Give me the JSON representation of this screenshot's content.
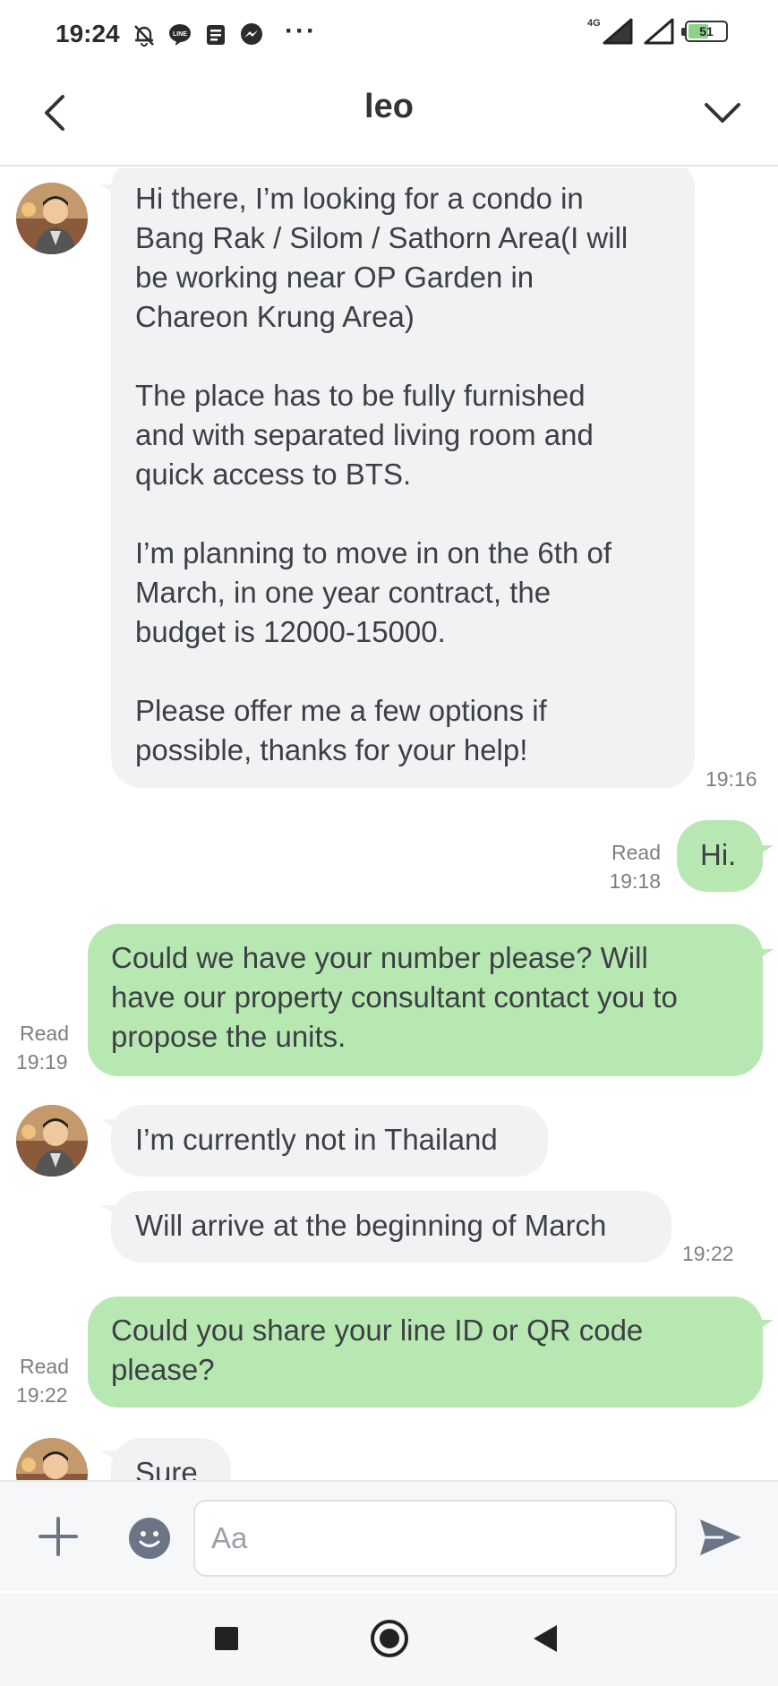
{
  "status_bar": {
    "time": "19:24",
    "notification_icons": [
      "mute-bell-icon",
      "line-icon",
      "news-icon",
      "messenger-icon"
    ],
    "overflow": "···",
    "network": "4G",
    "battery": "51",
    "battery_level_percent": 51
  },
  "header": {
    "title": "leo"
  },
  "messages": [
    {
      "direction": "incoming",
      "text": "Hi there, I’m looking for a condo in\nBang Rak / Silom / Sathorn Area(I will\nbe working near OP Garden in\nChareon Krung Area)\n\nThe place has to be fully furnished\nand with separated living room and\nquick access to BTS.\n\nI’m planning to move in on the 6th of\nMarch, in one year contract, the\nbudget is 12000-15000.\n\nPlease offer me a few options if\npossible, thanks for your help!",
      "time": "19:16"
    },
    {
      "direction": "outgoing",
      "text": "Hi.",
      "status": "Read",
      "time": "19:18"
    },
    {
      "direction": "outgoing",
      "text": "Could we have your number please? Will\nhave our property consultant contact you to\npropose the units.",
      "status": "Read",
      "time": "19:19"
    },
    {
      "direction": "incoming",
      "text": "I’m currently not in Thailand"
    },
    {
      "direction": "incoming",
      "text": "Will arrive at the beginning of March",
      "time": "19:22"
    },
    {
      "direction": "outgoing",
      "text": "Could you share your line ID or QR code\nplease?",
      "status": "Read",
      "time": "19:22"
    },
    {
      "direction": "incoming",
      "text": "Sure"
    }
  ],
  "composer": {
    "placeholder": "Aa"
  },
  "colors": {
    "incoming_bubble": "#f1f2f4",
    "outgoing_bubble": "#b8e8b2",
    "icon_gray": "#6c7585"
  }
}
